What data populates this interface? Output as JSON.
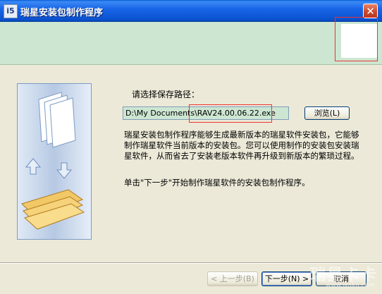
{
  "window": {
    "title": "瑞星安装包制作程序",
    "icon_text": "i5",
    "close_glyph": "✕"
  },
  "content": {
    "prompt": "请选择保存路径：",
    "path_value": "D:\\My Documents\\RAV24.00.06.22.exe",
    "browse_label": "浏览(L)",
    "description": "瑞星安装包制作程序能够生成最新版本的瑞星软件安装包，它能够制作瑞星软件当前版本的安装包。您可以使用制作的安装包安装瑞星软件，从而省去了安装老版本软件再升级到新版本的繁琐过程。",
    "instruction": "单击\"下一步\"开始制作瑞星软件的安装包制作程序。"
  },
  "buttons": {
    "back": "< 上一步(B)",
    "next": "下一步(N) >",
    "cancel": "取消"
  },
  "watermark": {
    "text": "瑞星卡卡",
    "url": "www.ikaka.com"
  },
  "colors": {
    "titlebar": "#0b53d0",
    "header_band": "#cde6d2",
    "annotation_red": "#ee3333"
  },
  "icons": {
    "side_illustration": "document-stack-with-arrows"
  }
}
